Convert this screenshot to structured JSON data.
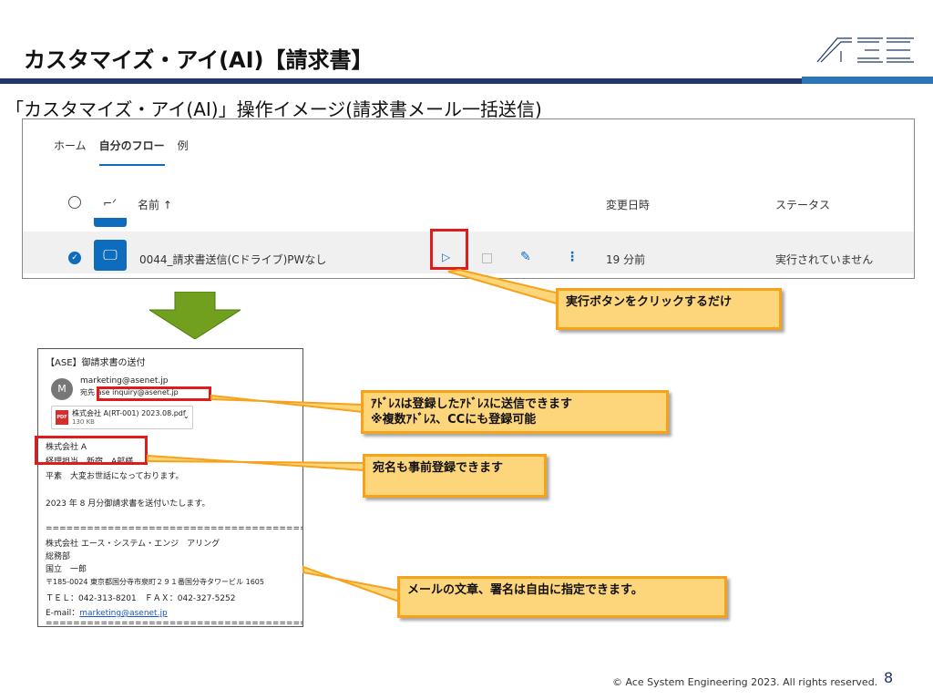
{
  "slide": {
    "title": "カスタマイズ・アイ(AI)【請求書】",
    "subtitle": "「カスタマイズ・アイ(AI)」操作イメージ(請求書メール一括送信)",
    "footer": "© Ace System Engineering 2023. All rights reserved.",
    "page_number": "8"
  },
  "flows": {
    "tabs": [
      "ホーム",
      "自分のフロー",
      "例"
    ],
    "header": {
      "name": "名前 ↑",
      "modified": "変更日時",
      "status": "ステータス"
    },
    "row": {
      "name": "0044_請求書送信(Cドライブ)PWなし",
      "modified": "19 分前",
      "status": "実行されていません"
    }
  },
  "email": {
    "subject": "【ASE】御請求書の送付",
    "sender": "marketing@asenet.jp",
    "to": "宛先 ase inquiry@asenet.jp",
    "attachment_name": "株式会社 A(RT-001) 2023.08.pdf",
    "attachment_size": "130 KB",
    "body": [
      "株式会社 A",
      "経理担当　新宿　A部様",
      "平素　大変お世話になっております。",
      "",
      "2023 年 8 月分御請求書を送付いたします。",
      "",
      "",
      "=========================================",
      "株式会社 エース・システム・エンジ　アリング",
      "総務部",
      "国立　一郎",
      "〒185-0024 東京都国分寺市泉町２９１番国分寺タワービル 1605",
      "ＴＥＬ：042-313-8201　ＦＡＸ：042-327-5252",
      "",
      "========================================"
    ],
    "email_label": "E-mail：",
    "email_link": "marketing@asenet.jp"
  },
  "callouts": {
    "run": "実行ボタンをクリックするだけ",
    "address_line1": "ｱﾄﾞﾚｽは登録したｱﾄﾞﾚｽに送信できます",
    "address_line2": "※複数ｱﾄﾞﾚｽ、CCにも登録可能",
    "recipient": "宛名も事前登録できます",
    "body": "メールの文章、署名は自由に指定できます。"
  },
  "colors": {
    "accent_blue": "#0f6cbd",
    "highlight_red": "#e01b1b",
    "callout_fill": "#fdd57b",
    "callout_border": "#f6a21b",
    "arrow_green": "#70a01e"
  }
}
